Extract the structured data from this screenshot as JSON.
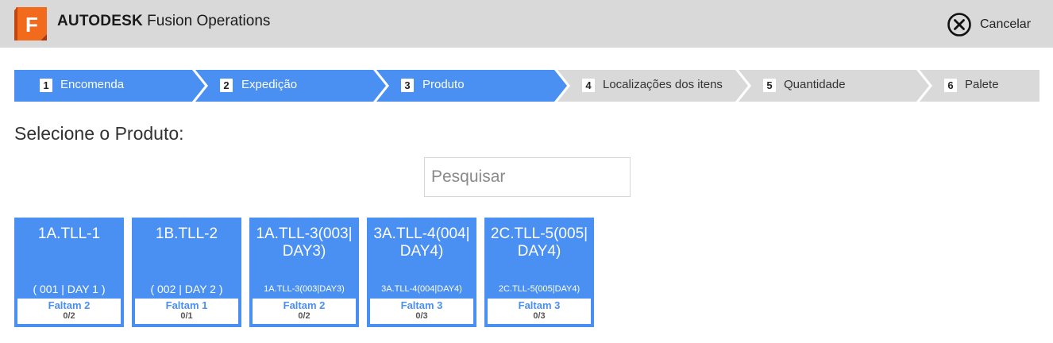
{
  "header": {
    "logo_letter": "F",
    "brand_bold": "AUTODESK",
    "brand_rest": "Fusion Operations",
    "cancel_label": "Cancelar",
    "cancel_icon": "close-circle-icon",
    "colors": {
      "header_bg": "#d9d9d9",
      "logo_orange": "#f26b1d"
    }
  },
  "stepper": {
    "steps": [
      {
        "number": "1",
        "label": "Encomenda",
        "state": "done"
      },
      {
        "number": "2",
        "label": "Expedição",
        "state": "done"
      },
      {
        "number": "3",
        "label": "Produto",
        "state": "current"
      },
      {
        "number": "4",
        "label": "Localizações dos itens",
        "state": "pending"
      },
      {
        "number": "5",
        "label": "Quantidade",
        "state": "pending"
      },
      {
        "number": "6",
        "label": "Palete",
        "state": "pending"
      }
    ],
    "colors": {
      "active": "#4a8ff2",
      "inactive": "#d9d9d9"
    }
  },
  "main": {
    "title": "Selecione o Produto:",
    "search_placeholder": "Pesquisar",
    "products": [
      {
        "name": "1A.TLL-1",
        "code": "( 001 | DAY 1 )",
        "missing": "Faltam 2",
        "count": "0/2"
      },
      {
        "name": "1B.TLL-2",
        "code": "( 002 | DAY 2 )",
        "missing": "Faltam 1",
        "count": "0/1"
      },
      {
        "name": "1A.TLL-3(003|DAY3)",
        "code": "1A.TLL-3(003|DAY3)",
        "missing": "Faltam 2",
        "count": "0/2"
      },
      {
        "name": "3A.TLL-4(004|DAY4)",
        "code": "3A.TLL-4(004|DAY4)",
        "missing": "Faltam 3",
        "count": "0/3"
      },
      {
        "name": "2C.TLL-5(005|DAY4)",
        "code": "2C.TLL-5(005|DAY4)",
        "missing": "Faltam 3",
        "count": "0/3"
      }
    ]
  }
}
